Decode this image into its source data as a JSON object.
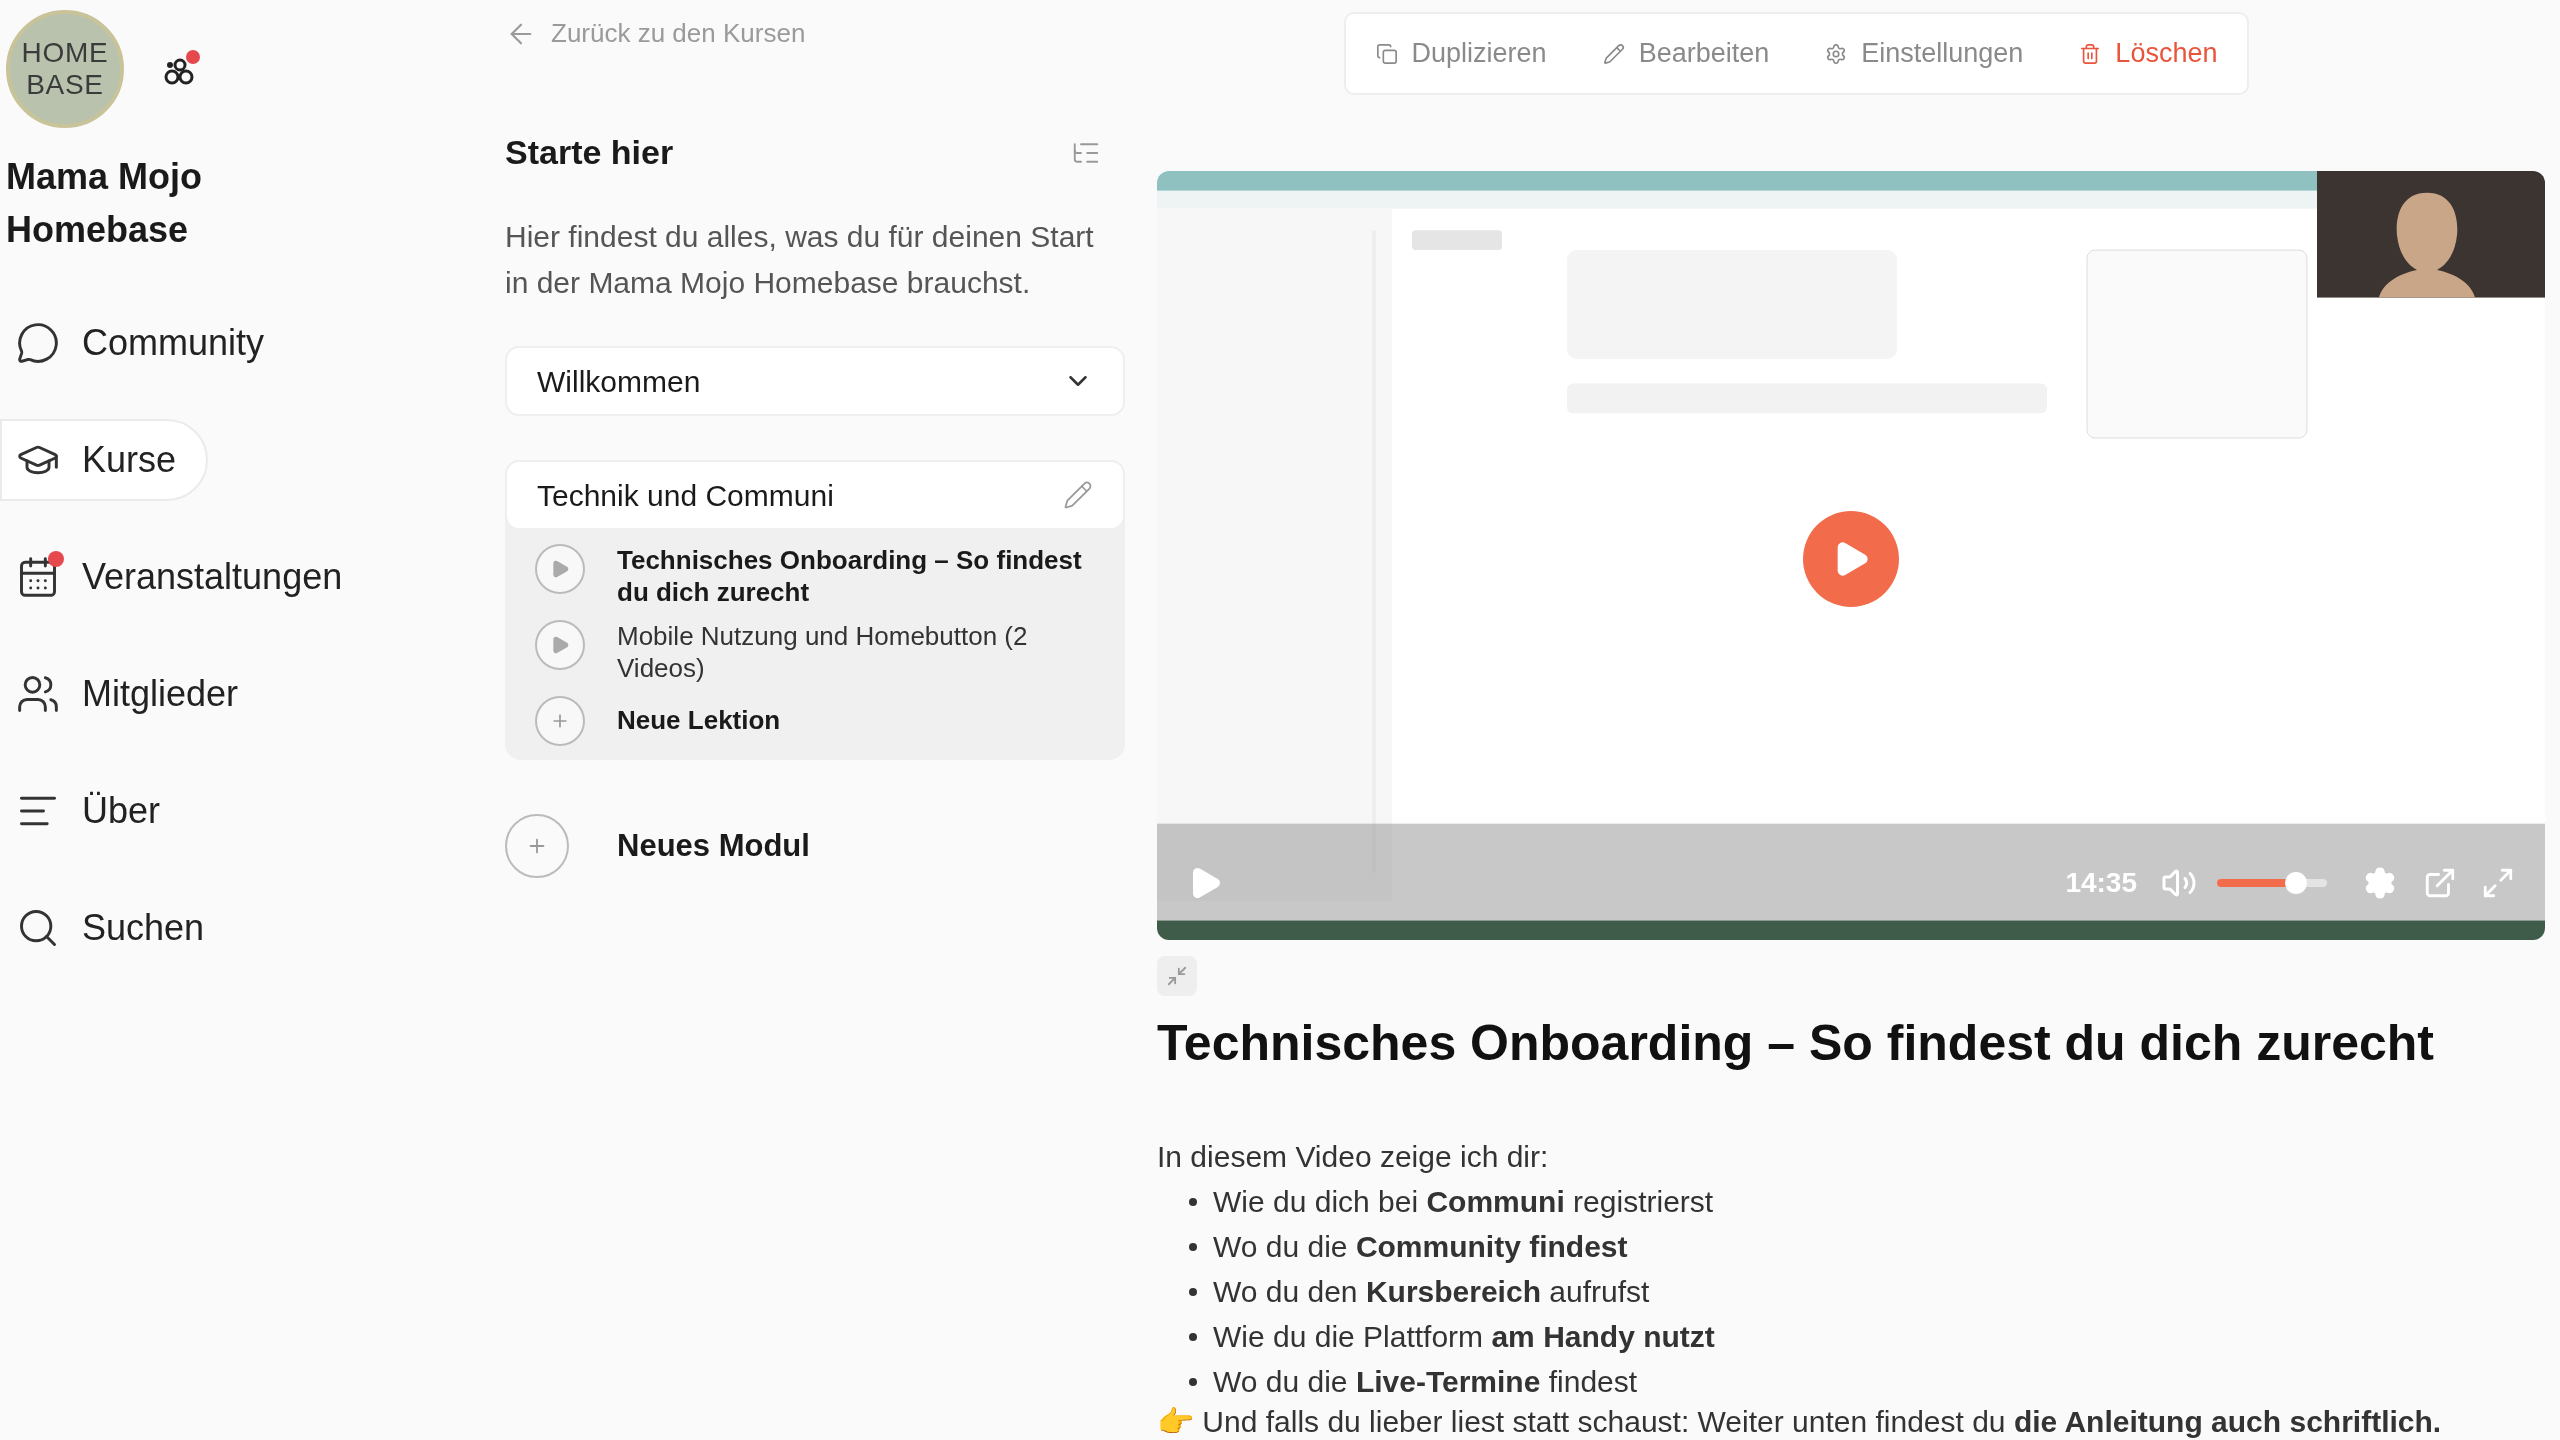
{
  "sidebar": {
    "logo": {
      "line1": "HOME",
      "line2": "BASE"
    },
    "notification_dot": true,
    "community_name": "Mama Mojo Homebase",
    "items": [
      {
        "label": "Community",
        "kind": "community",
        "selected": false,
        "badge": false
      },
      {
        "label": "Kurse",
        "kind": "courses",
        "selected": true,
        "badge": false
      },
      {
        "label": "Veranstaltungen",
        "kind": "events",
        "selected": false,
        "badge": true
      },
      {
        "label": "Mitglieder",
        "kind": "members",
        "selected": false,
        "badge": false
      },
      {
        "label": "Über",
        "kind": "about",
        "selected": false,
        "badge": false
      },
      {
        "label": "Suchen",
        "kind": "search",
        "selected": false,
        "badge": false
      }
    ]
  },
  "back_link": "Zurück zu den Kursen",
  "course": {
    "title": "Starte hier",
    "description": "Hier findest du alles, was du für deinen Start in der Mama Mojo Homebase brauchst.",
    "modules": [
      {
        "title": "Willkommen",
        "expanded": false
      },
      {
        "title": "Technik und Communi",
        "expanded": true,
        "lessons": [
          {
            "title": "Technisches Onboarding – So findest du dich zurecht",
            "kind": "video",
            "selected": true
          },
          {
            "title": "Mobile Nutzung und Homebutton (2 Videos)",
            "kind": "video",
            "selected": false
          },
          {
            "title": "Neue Lektion",
            "kind": "add",
            "selected": false
          }
        ]
      }
    ],
    "new_module": "Neues Modul"
  },
  "actions": [
    {
      "label": "Duplizieren",
      "kind": "duplicate"
    },
    {
      "label": "Bearbeiten",
      "kind": "edit"
    },
    {
      "label": "Einstellungen",
      "kind": "settings"
    },
    {
      "label": "Löschen",
      "kind": "delete"
    }
  ],
  "video": {
    "kind": "picture",
    "time": "14:35",
    "volume": {
      "level": 0.82
    }
  },
  "lesson": {
    "title": "Technisches Onboarding – So findest du dich zurecht",
    "intro": "In diesem Video zeige ich dir:",
    "bullets": [
      "Wie du dich bei **Communi** registrierst",
      "Wo du die **Community findest**",
      "Wo du den **Kursbereich** aufrufst",
      "Wie du die Plattform **am Handy nutzt**",
      "Wo du die **Live-Termine** findest"
    ],
    "note": "👉 Und falls du lieber liest statt schaust: Weiter unten findest du **die Anleitung auch schriftlich.**"
  }
}
